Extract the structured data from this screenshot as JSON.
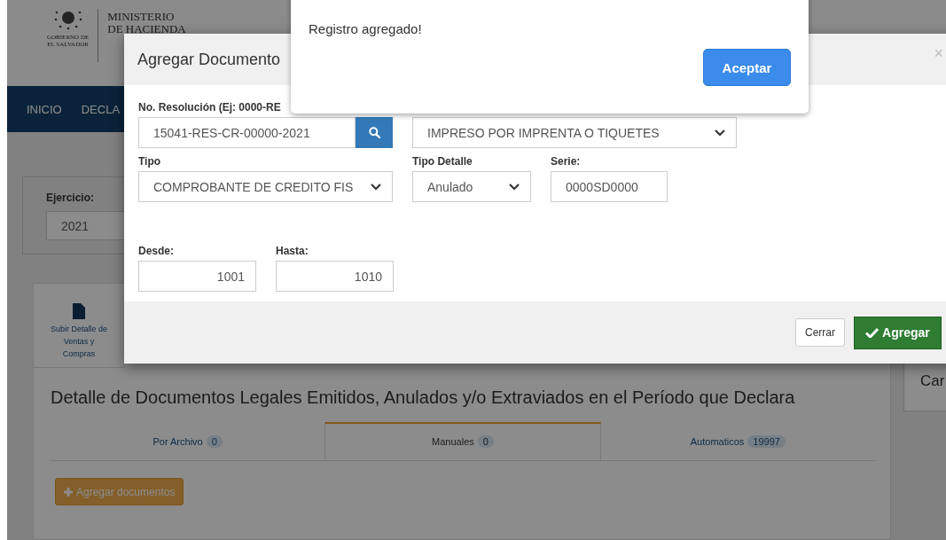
{
  "header": {
    "logo_caption": [
      "GOBIERNO DE",
      "EL SALVADOR"
    ],
    "ministry": [
      "MINISTERIO",
      "DE HACIENDA"
    ]
  },
  "nav": [
    {
      "label": "INICIO"
    },
    {
      "label": "DECLA"
    }
  ],
  "ejercicio": {
    "label": "Ejercicio:",
    "value": "2021"
  },
  "upload": {
    "label": "Subir Detalle de Ventas y Compras"
  },
  "section_title": "Detalle de Documentos Legales Emitidos, Anulados y/o Extraviados en el Período que Declara",
  "tabs": [
    {
      "label": "Por Archivo",
      "count": "0",
      "selected": false
    },
    {
      "label": "Manuales",
      "count": "0",
      "selected": true
    },
    {
      "label": "Automaticos",
      "count": "19997",
      "selected": false
    }
  ],
  "add_button": "Agregar documentos",
  "side_button": "Car",
  "modal": {
    "title": "Agregar Documento",
    "close": "×",
    "resolution": {
      "label": "No. Resolución (Ej: 0000-RE",
      "value": "15041-RES-CR-00000-2021"
    },
    "medium": {
      "value": "IMPRESO POR IMPRENTA O TIQUETES"
    },
    "tipo": {
      "label": "Tipo",
      "value": "COMPROBANTE DE CREDITO FIS"
    },
    "tipo_detalle": {
      "label": "Tipo Detalle",
      "value": "Anulado"
    },
    "serie": {
      "label": "Serie:",
      "value": "0000SD0000"
    },
    "desde": {
      "label": "Desde:",
      "value": "1001"
    },
    "hasta": {
      "label": "Hasta:",
      "value": "1010"
    },
    "buttons": {
      "cancel": "Cerrar",
      "submit": "Agregar"
    }
  },
  "alert": {
    "message": "Registro agregado!",
    "button": "Aceptar"
  }
}
